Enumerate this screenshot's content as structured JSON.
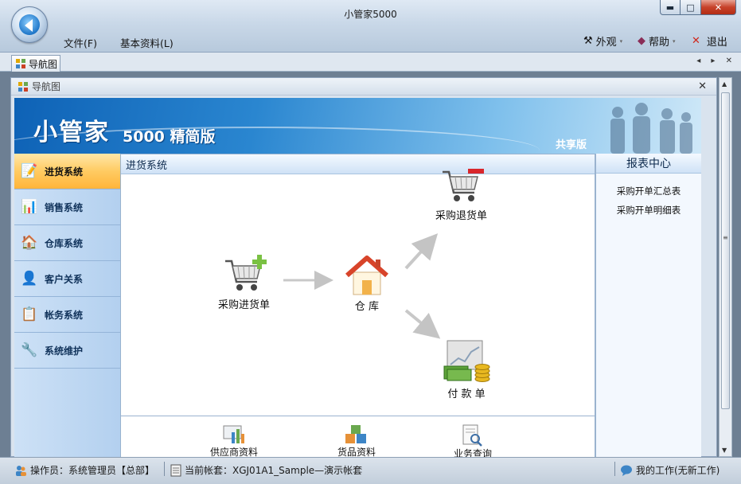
{
  "window": {
    "title": "小管家5000",
    "min_glyph": "▬",
    "max_glyph": "□",
    "close_glyph": "✕"
  },
  "menu": {
    "file": "文件(F)",
    "basic": "基本资料(L)"
  },
  "toolbar": {
    "appearance": "外观",
    "help": "帮助",
    "exit": "退出"
  },
  "tabs": {
    "nav": "导航图",
    "controls": "◂ ▸ ✕"
  },
  "navwindow": {
    "title": "导航图",
    "close_glyph": "✕"
  },
  "banner": {
    "main": "小管家",
    "sub": "5000 精简版",
    "edition": "共享版"
  },
  "sidebar": {
    "items": [
      {
        "label": "进货系统"
      },
      {
        "label": "销售系统"
      },
      {
        "label": "仓库系统"
      },
      {
        "label": "客户关系"
      },
      {
        "label": "帐务系统"
      },
      {
        "label": "系统维护"
      }
    ]
  },
  "section": {
    "title": "进货系统"
  },
  "flow": {
    "purchase": "采购进货单",
    "warehouse": "仓 库",
    "return": "采购退货单",
    "payment": "付 款 单"
  },
  "bottom": {
    "supplier": "供应商资料",
    "goods": "货品资料",
    "query": "业务查询"
  },
  "reports": {
    "title": "报表中心",
    "items": [
      "采购开单汇总表",
      "采购开单明细表"
    ]
  },
  "status": {
    "operator": "操作员：系统管理员【总部】",
    "account": "当前帐套：XGJ01A1_Sample—演示帐套",
    "work": "我的工作(无新工作)"
  },
  "colors": {
    "accent": "#ffcb62",
    "banner": "#1f77c9"
  }
}
